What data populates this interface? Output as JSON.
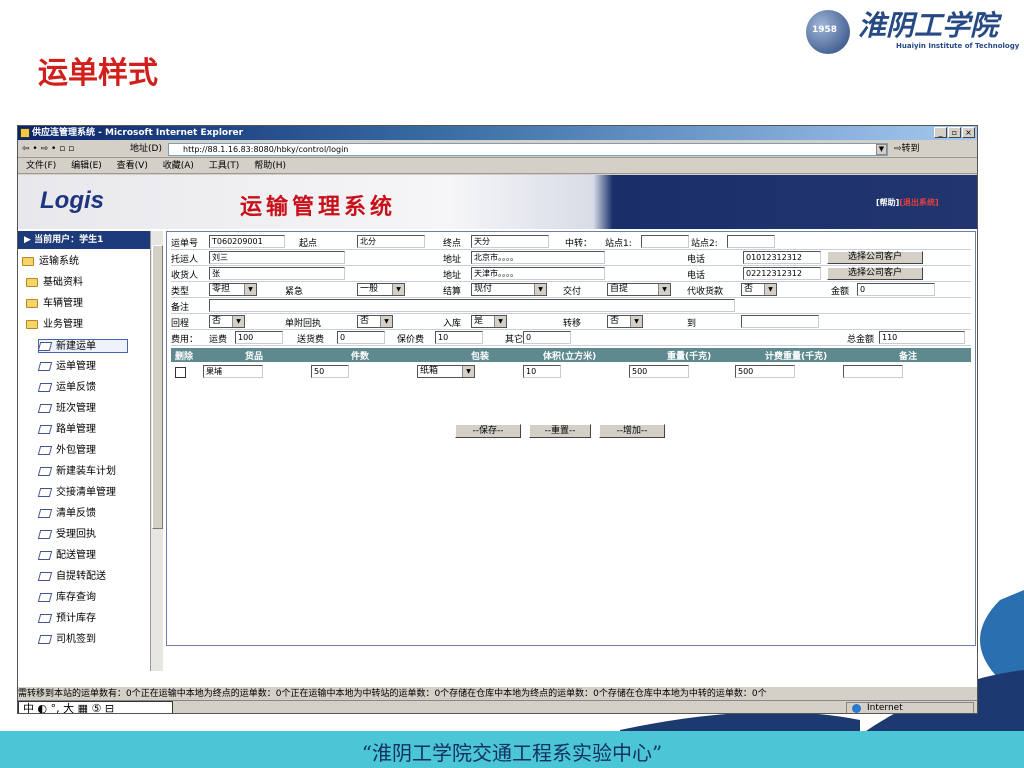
{
  "slide": {
    "title": "运单样式",
    "footer": "“淮阴工学院交通工程系实验中心”"
  },
  "logo": {
    "cn": "淮阴工学院",
    "en": "Huaiyin Institute of Technology",
    "year": "1958"
  },
  "browser": {
    "title": "供应连管理系统 - Microsoft Internet Explorer",
    "address_label": "地址(D)",
    "url": "http://88.1.16.83:8080/hbky/control/login",
    "go_label": "转到",
    "menu": [
      "文件(F)",
      "编辑(E)",
      "查看(V)",
      "收藏(A)",
      "工具(T)",
      "帮助(H)"
    ],
    "min": "_",
    "max": "▫",
    "close": "×",
    "status_internet": "Internet",
    "ime": "中 ◐ °, 大 ▦ ⑤ ⊟"
  },
  "app": {
    "logo": "Logis",
    "system_name": "运输管理系统",
    "help": "[帮助]",
    "exit": "[退出系统]"
  },
  "sidebar": {
    "user": "当前用户：学生1",
    "items": [
      "运输系统",
      "基础资料",
      "车辆管理",
      "业务管理",
      "新建运单",
      "运单管理",
      "运单反馈",
      "班次管理",
      "路单管理",
      "外包管理",
      "新建装车计划",
      "交接清单管理",
      "清单反馈",
      "受理回执",
      "配送管理",
      "自提转配送",
      "库存查询",
      "预计库存",
      "司机签到"
    ]
  },
  "form": {
    "waybill_no_label": "运单号",
    "waybill_no": "T060209001",
    "origin_label": "起点",
    "origin": "北分",
    "dest_label": "终点",
    "dest": "天分",
    "transfer_label": "中转：",
    "station1_label": "站点1:",
    "station1": "",
    "station2_label": "站点2:",
    "station2": "",
    "shipper_label": "托运人",
    "shipper": "刘三",
    "shipper_addr_label": "地址",
    "shipper_addr": "北京市。。。。",
    "shipper_phone_label": "电话",
    "shipper_phone": "01012312312",
    "choose_btn1": "选择公司客户",
    "consignee_label": "收货人",
    "consignee": "张",
    "consignee_addr_label": "地址",
    "consignee_addr": "天津市。。。。",
    "consignee_phone_label": "电话",
    "consignee_phone": "02212312312",
    "choose_btn2": "选择公司客户",
    "type_label": "类型",
    "type": "零担",
    "urgent_label": "紧急",
    "urgent": "一般",
    "settle_label": "结算",
    "settle": "现付",
    "deliver_label": "交付",
    "deliver": "自提",
    "cod_label": "代收货款",
    "cod": "否",
    "amount_label": "金额",
    "amount": "0",
    "remark_label": "备注",
    "remark": "",
    "return_label": "回程",
    "return": "否",
    "receipt_label": "单附回执",
    "receipt": "否",
    "instock_label": "入库",
    "instock": "是",
    "transfer2_label": "转移",
    "transfer2": "否",
    "to_label": "到",
    "to": "",
    "fee_label": "费用：",
    "freight_label": "运费",
    "freight": "100",
    "delivery_fee_label": "送货费",
    "delivery_fee": "0",
    "insurance_label": "保价费",
    "insurance": "10",
    "other_label": "其它",
    "other": "0",
    "total_label": "总金额",
    "total": "110"
  },
  "grid": {
    "headers": [
      "删除",
      "货品",
      "件数",
      "包装",
      "体积(立方米)",
      "重量(千克)",
      "计费重量(千克)",
      "备注"
    ],
    "row": {
      "goods": "果埔",
      "qty": "50",
      "pack": "纸箱",
      "volume": "10",
      "weight": "500",
      "charge_weight": "500",
      "remark": ""
    }
  },
  "actions": {
    "save": "--保存--",
    "reset": "--重置--",
    "add": "--增加--"
  },
  "statusline": "需转移到本站的运单数有：0个正在运输中本地为终点的运单数：0个正在运输中本地为中转站的运单数：0个存储在仓库中本地为终点的运单数：0个存储在仓库中本地为中转的运单数：0个"
}
